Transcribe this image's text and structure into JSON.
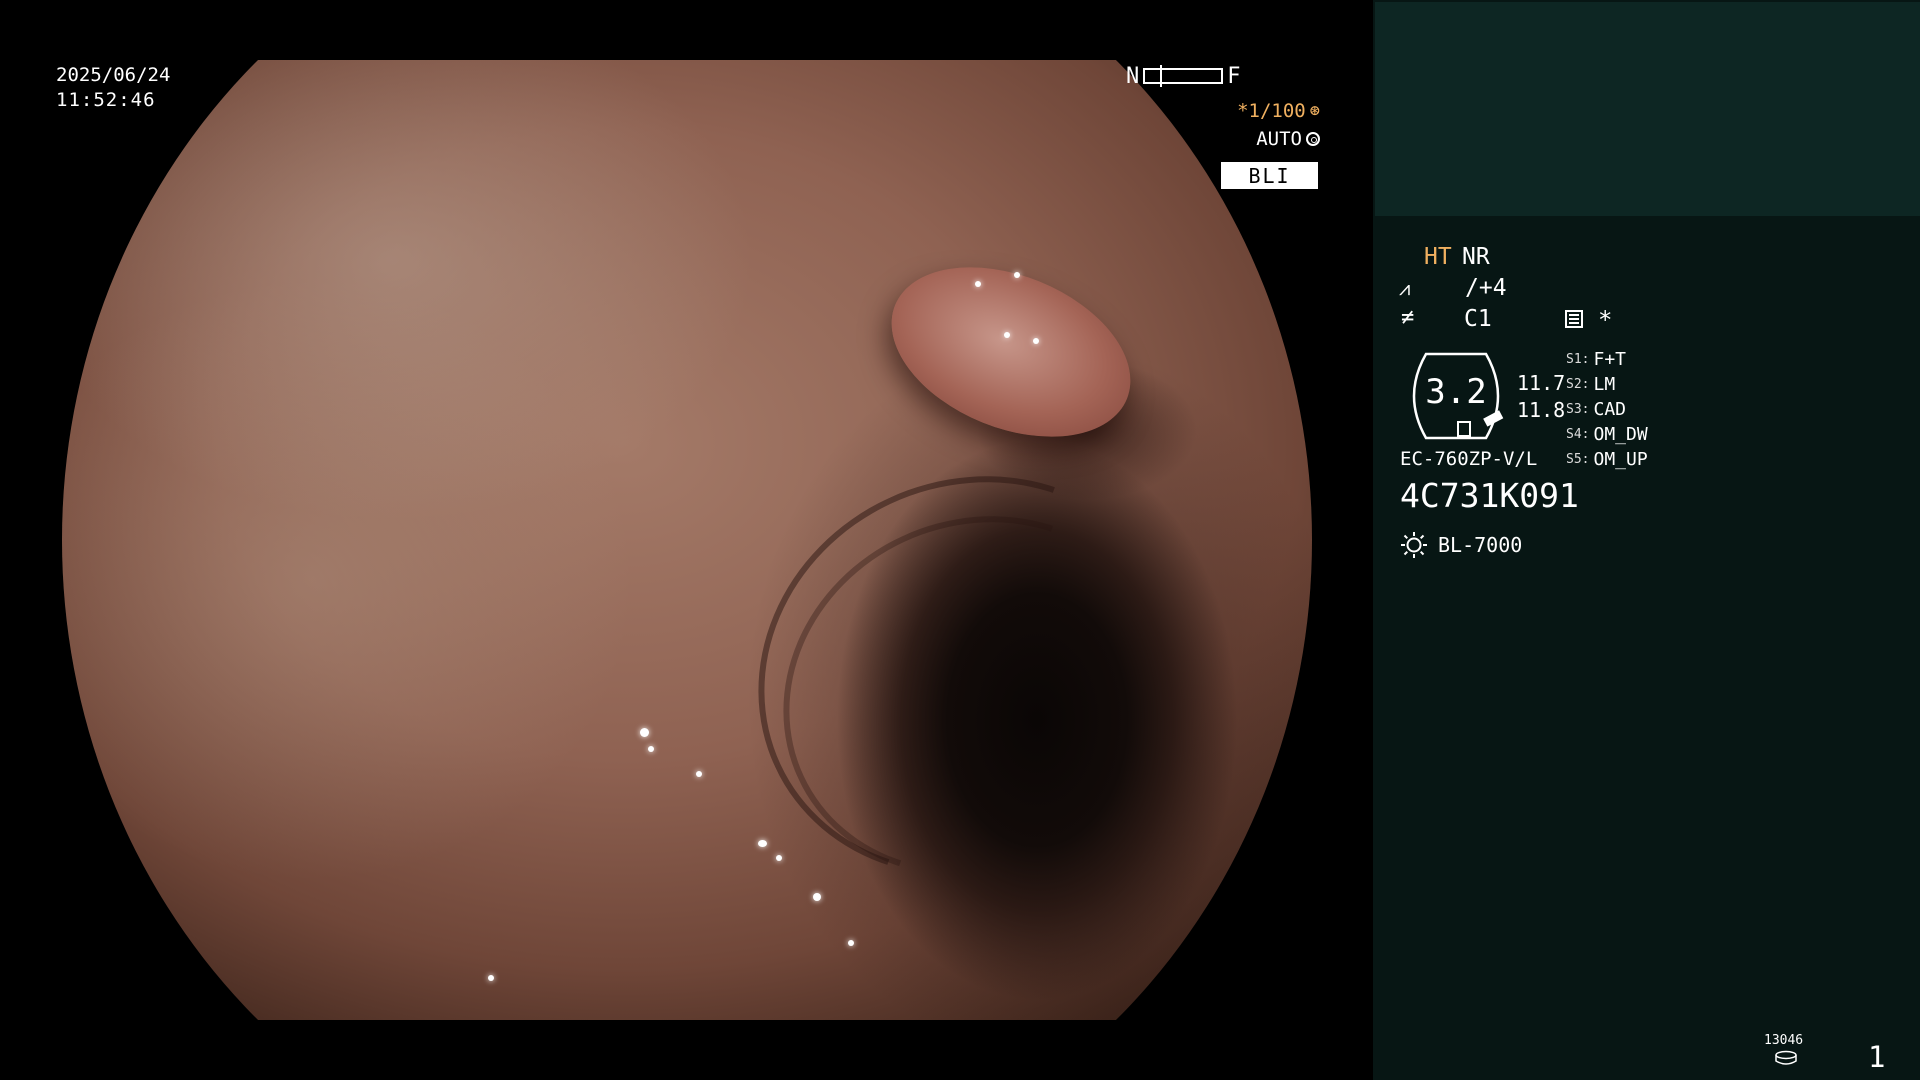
{
  "image_overlay": {
    "date": "2025/06/24",
    "time": "11:52:46",
    "near_far": {
      "near_label": "N",
      "far_label": "F",
      "position": 0.2
    },
    "shutter": "*1/100",
    "iris_mode": "AUTO",
    "light_mode": "BLI"
  },
  "info_panel": {
    "ht_label": "HT",
    "nr_label": "NR",
    "structure_enhancement_icon": "enhancement-icon",
    "structure_enhancement_value": "/+4",
    "color_mode_icon": "color-tone-icon",
    "color_mode_value": "C1",
    "preset_icon": "menu-settings-icon",
    "preset_marker": "*",
    "magnification": "3.2",
    "mag_far": "11.7",
    "mag_near": "11.8",
    "switches": [
      {
        "key": "S1:",
        "value": "F+T"
      },
      {
        "key": "S2:",
        "value": "LM"
      },
      {
        "key": "S3:",
        "value": "CAD"
      },
      {
        "key": "S4:",
        "value": "OM_DW"
      },
      {
        "key": "S5:",
        "value": "OM_UP"
      }
    ],
    "scope_model": "EC-760ZP-V/L",
    "scope_serial": "4C731K091",
    "light_source": "BL-7000",
    "image_count": "13046",
    "page_number": "1"
  },
  "colors": {
    "background": "#000000",
    "panel": "#071614",
    "panel_top": "#0d2623",
    "accent_orange": "#f0b060"
  }
}
